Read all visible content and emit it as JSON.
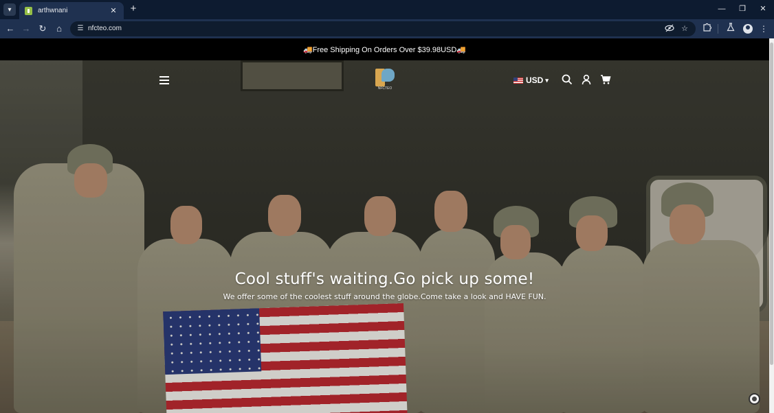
{
  "browser": {
    "tab": {
      "title": "arthwnani",
      "close_glyph": "✕"
    },
    "new_tab_glyph": "+",
    "url": "nfcteo.com",
    "icons": {
      "back": "back-arrow-icon",
      "forward": "forward-arrow-icon",
      "reload": "reload-icon",
      "home": "home-icon",
      "site_info": "tune-icon",
      "eye_off": "eye-off-icon",
      "bookmark": "star-icon",
      "extensions": "puzzle-icon",
      "labs": "flask-icon",
      "profile": "profile-icon",
      "menu": "more-vertical-icon"
    },
    "window_controls": {
      "minimize": "—",
      "restore": "❐",
      "close": "✕"
    }
  },
  "store": {
    "announcement": "🚚Free Shipping On Orders Over $39.98USD🚚",
    "logo_text": "NFCTEO",
    "currency": {
      "code": "USD",
      "flag_icon": "us-flag-icon"
    },
    "hero": {
      "title": "Cool stuff's waiting.Go pick up some!",
      "subtitle": "We offer some of the coolest stuff around the globe.Come take a look and HAVE FUN."
    }
  },
  "colors": {
    "browser_frame": "#0d1b30",
    "browser_toolbar": "#1f3150",
    "announcement_bg": "#000000",
    "hero_text": "#ffffff"
  }
}
